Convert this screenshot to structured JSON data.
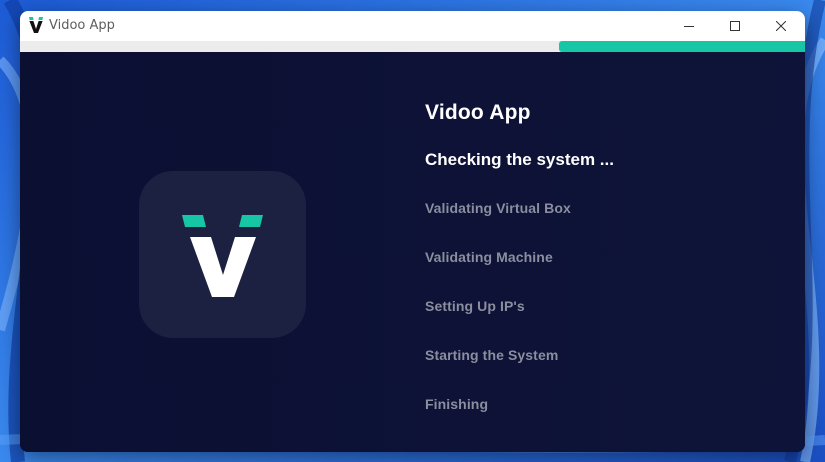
{
  "window": {
    "title": "Vidoo App",
    "progress_fraction": 0.313
  },
  "main": {
    "heading": "Vidoo App",
    "status": "Checking the system ...",
    "steps": [
      "Validating Virtual Box",
      "Validating Machine",
      "Setting Up IP's",
      "Starting the System",
      "Finishing"
    ]
  },
  "icons": {
    "app": "vidoo-logo-icon",
    "minimize": "minimize-icon",
    "maximize": "maximize-icon",
    "close": "close-icon"
  },
  "colors": {
    "accent": "#16c6a4",
    "background": "#0b1031",
    "tile": "#1c2141",
    "step_text": "#8a8e9e"
  }
}
